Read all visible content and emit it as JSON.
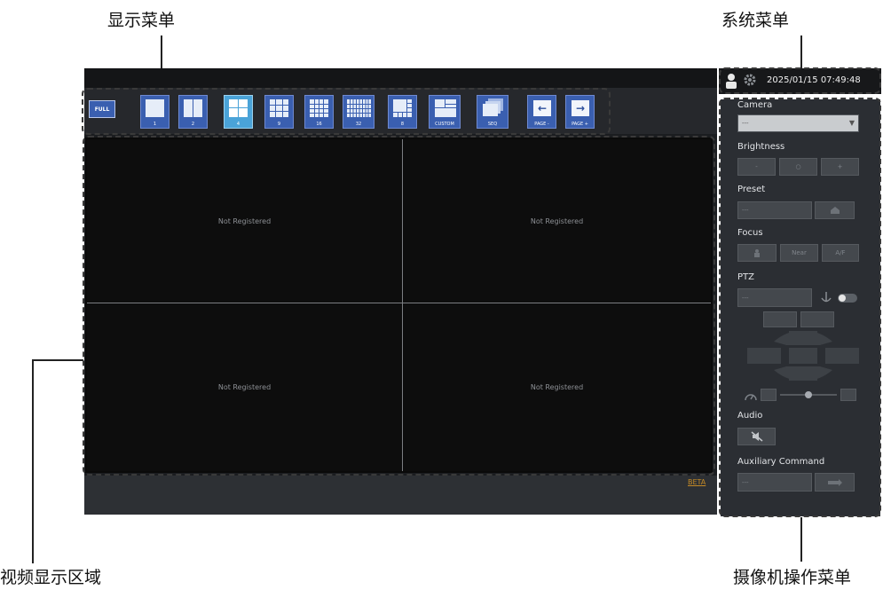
{
  "callouts": {
    "display_menu": "显示菜单",
    "system_menu": "系统菜单",
    "video_area": "视频显示区域",
    "camera_menu": "摄像机操作菜单"
  },
  "display_menu": {
    "full_label": "FULL",
    "layout_buttons": [
      {
        "label": "1",
        "icon": "single-screen-icon"
      },
      {
        "label": "2",
        "icon": "two-split-icon"
      },
      {
        "label": "4",
        "icon": "four-split-icon",
        "active": true
      },
      {
        "label": "9",
        "icon": "nine-split-icon"
      },
      {
        "label": "16",
        "icon": "sixteen-split-icon"
      },
      {
        "label": "32",
        "icon": "thirtytwo-split-icon"
      },
      {
        "label": "8",
        "icon": "eight-split-icon"
      },
      {
        "label": "CUSTOM",
        "icon": "custom-layout-icon"
      },
      {
        "label": "SEQ",
        "icon": "sequence-icon"
      },
      {
        "label": "PAGE -",
        "icon": "arrow-left-icon"
      },
      {
        "label": "PAGE +",
        "icon": "arrow-right-icon"
      }
    ]
  },
  "video_area": {
    "cells": [
      "Not Registered",
      "Not Registered",
      "Not Registered",
      "Not Registered"
    ]
  },
  "bottom_bar": {
    "brand": "BETA"
  },
  "system_menu": {
    "datetime": "2025/01/15 07:49:48",
    "icons": [
      "user-icon",
      "gear-icon"
    ]
  },
  "camera_panel": {
    "camera_label": "Camera",
    "camera_value": "---",
    "brightness_label": "Brightness",
    "brightness_buttons": [
      "-",
      "○",
      "+"
    ],
    "preset_label": "Preset",
    "preset_value": "---",
    "focus_label": "Focus",
    "focus_buttons": [
      "",
      "Near",
      "A/F"
    ],
    "ptz_label": "PTZ",
    "ptz_value": "---",
    "audio_label": "Audio",
    "aux_label": "Auxiliary Command",
    "aux_value": "---"
  },
  "colors": {
    "accent_button": "#3a5fb0",
    "active_button": "#4aa3d8",
    "panel_bg": "#2b2e33",
    "video_bg": "#0d0d0d",
    "brand": "#c48a26"
  }
}
